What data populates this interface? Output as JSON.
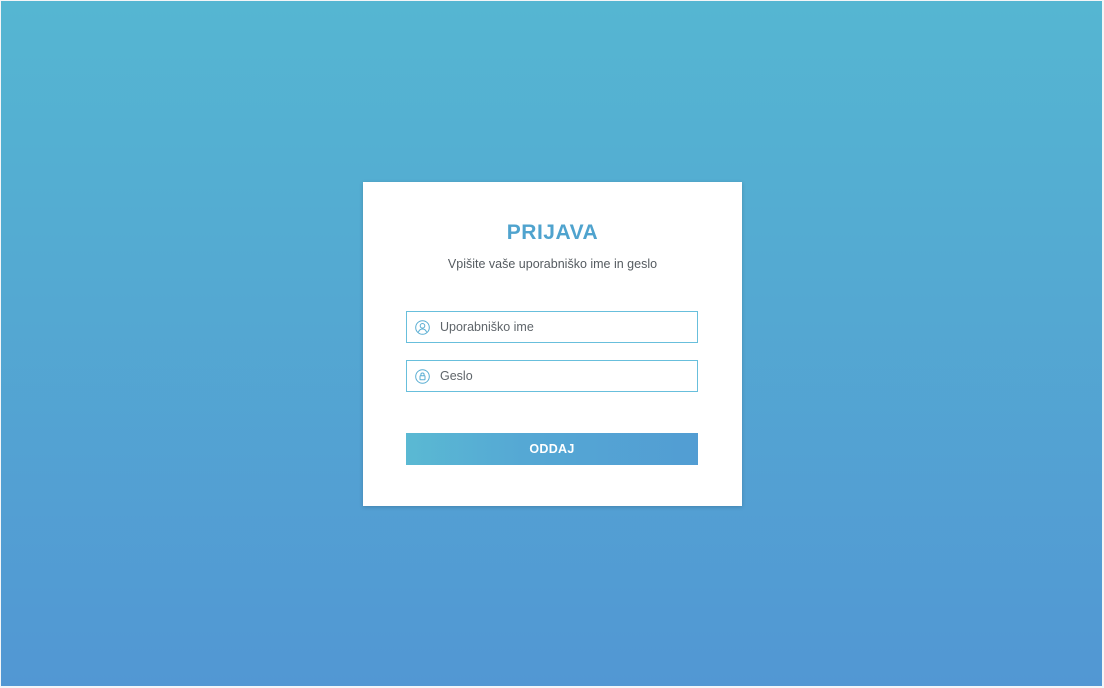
{
  "login": {
    "title": "PRIJAVA",
    "subtitle": "Vpišite vaše uporabniško ime in geslo",
    "username": {
      "value": "",
      "placeholder": "Uporabniško ime",
      "icon": "user-icon"
    },
    "password": {
      "value": "",
      "placeholder": "Geslo",
      "icon": "lock-icon"
    },
    "submit_label": "ODDAJ"
  },
  "colors": {
    "background_top": "#55b6d2",
    "background_bottom": "#5297d3",
    "accent": "#4fa3ce",
    "field_border": "#68bfdc",
    "button_gradient_start": "#5ab9d3",
    "button_gradient_end": "#529dd3"
  }
}
